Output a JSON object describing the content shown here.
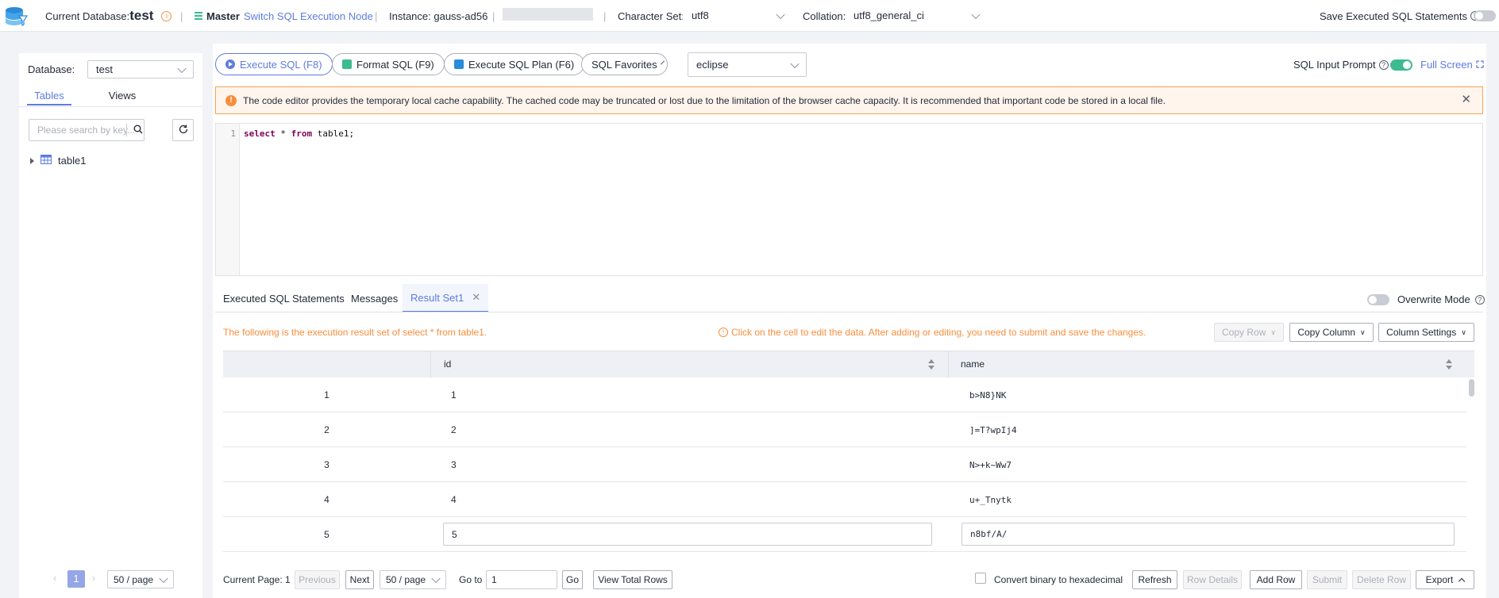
{
  "topbar": {
    "current_db_label": "Current Database:",
    "current_db_value": "test",
    "master_label": "Master",
    "switch_node_link": "Switch SQL Execution Node",
    "instance_label": "Instance: gauss-ad56",
    "charset_label": "Character Set:",
    "charset_value": "utf8",
    "collation_label": "Collation:",
    "collation_value": "utf8_general_ci",
    "save_statements_label": "Save Executed SQL Statements"
  },
  "sidebar": {
    "database_label": "Database:",
    "database_value": "test",
    "tabs": [
      "Tables",
      "Views"
    ],
    "search_placeholder": "Please search by key...",
    "tree_items": [
      "table1"
    ],
    "pagination": {
      "current_page": "1",
      "page_size": "50 / page"
    }
  },
  "toolbar": {
    "execute_sql": "Execute SQL (F8)",
    "format_sql": "Format SQL (F9)",
    "execute_plan": "Execute SQL Plan (F6)",
    "favorites": "SQL Favorites",
    "theme_value": "eclipse",
    "input_prompt_label": "SQL Input Prompt",
    "full_screen": "Full Screen"
  },
  "notice": {
    "text": "The code editor provides the temporary local cache capability. The cached code may be truncated or lost due to the limitation of the browser cache capacity. It is recommended that important code be stored in a local file."
  },
  "editor": {
    "line_number": "1",
    "keyword1": "select",
    "rest1": " * ",
    "keyword2": "from",
    "rest2": " table1;"
  },
  "result_tabs": {
    "executed": "Executed SQL Statements",
    "messages": "Messages",
    "result_set": "Result Set1",
    "overwrite_mode": "Overwrite Mode"
  },
  "result": {
    "info_text": "The following is the execution result set of select * from table1.",
    "edit_hint": "Click on the cell to edit the data. After adding or editing, you need to submit and save the changes.",
    "copy_row": "Copy Row",
    "copy_column": "Copy Column",
    "column_settings": "Column Settings",
    "columns": [
      "id",
      "name"
    ],
    "rows": [
      {
        "num": "1",
        "id": "1",
        "name": "b>N8}NK"
      },
      {
        "num": "2",
        "id": "2",
        "name": "]=T?wpIj4"
      },
      {
        "num": "3",
        "id": "3",
        "name": "N>+k~Ww7"
      },
      {
        "num": "4",
        "id": "4",
        "name": "u+_Tnytk"
      },
      {
        "num": "5",
        "id": "5",
        "name": "n8bf/A/"
      }
    ]
  },
  "footer": {
    "current_page": "Current Page: 1",
    "previous": "Previous",
    "next": "Next",
    "page_size": "50 / page",
    "goto_label": "Go to",
    "goto_value": "1",
    "go": "Go",
    "view_total": "View Total Rows",
    "convert_binary": "Convert binary to hexadecimal",
    "refresh": "Refresh",
    "row_details": "Row Details",
    "add_row": "Add Row",
    "submit": "Submit",
    "delete_row": "Delete Row",
    "export": "Export"
  },
  "colors": {
    "accent": "#5e7ce0",
    "warning": "#f98e3d",
    "toggle_on": "#3dbb8e",
    "info_text": "#f66f6a"
  }
}
